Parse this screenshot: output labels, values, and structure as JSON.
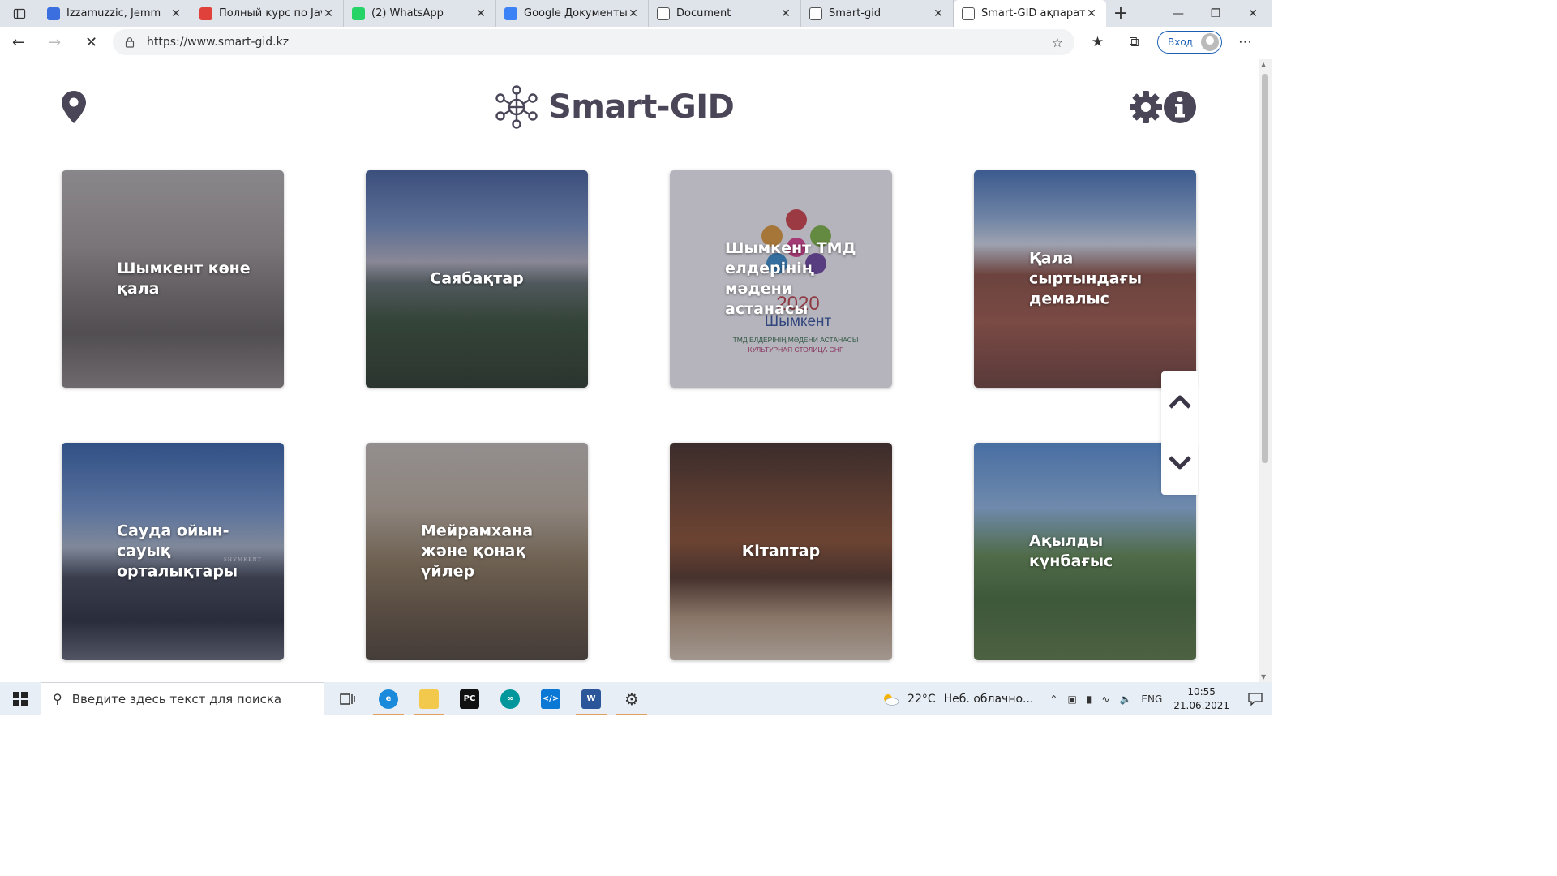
{
  "browser": {
    "tabs": [
      {
        "title": "Izzamuzzic, Jemm",
        "fav_color": "#3b6fe0",
        "icon": "media-player-icon"
      },
      {
        "title": "Полный курс по Java",
        "fav_color": "#e0413a",
        "icon": "course-site-icon"
      },
      {
        "title": "(2) WhatsApp",
        "fav_color": "#25d366",
        "icon": "whatsapp-icon"
      },
      {
        "title": "Google Документы",
        "fav_color": "#3b82f6",
        "icon": "google-docs-icon"
      },
      {
        "title": "Document",
        "fav_color": "#ffffff",
        "icon": "page-icon"
      },
      {
        "title": "Smart-gid",
        "fav_color": "#ffffff",
        "icon": "page-icon"
      },
      {
        "title": "Smart-GID ақпаратты",
        "fav_color": "#ffffff",
        "icon": "loading-icon"
      }
    ],
    "active_tab_index": 6,
    "url": "https://www.smart-gid.kz",
    "signin_label": "Вход"
  },
  "site": {
    "brand": "Smart-GID",
    "brand_color": "#4a4658",
    "cards": [
      {
        "label": "Шымкент көне қала",
        "theme": "old-city-sepia"
      },
      {
        "label": "Саябақтар",
        "theme": "park-evening"
      },
      {
        "label": "Шымкент ТМД елдерінің мәдени астанасы",
        "theme": "logo-card",
        "logo_year": "2020",
        "logo_city": "Шымкент",
        "logo_line1": "ТМД ЕЛДЕРІНІҢ МӘДЕНИ АСТАНАСЫ",
        "logo_line2": "КУЛЬТУРНАЯ СТОЛИЦА СНГ"
      },
      {
        "label": "Қала сыртындағы демалыс",
        "theme": "hotel-sky"
      },
      {
        "label": "Сауда ойын-сауық орталықтары",
        "theme": "mall-blue",
        "mall_sign": "SHYMKENT"
      },
      {
        "label": "Мейрамхана және қонақ үйлер",
        "theme": "restaurant-warm"
      },
      {
        "label": "Кітаптар",
        "theme": "library-brown"
      },
      {
        "label": "Ақылды күнбағыс",
        "theme": "solar-tree-green"
      }
    ]
  },
  "taskbar": {
    "search_placeholder": "Введите здесь текст для поиска",
    "weather_temp": "22°C",
    "weather_text": "Неб. облачно...",
    "lang": "ENG",
    "time": "10:55",
    "date": "21.06.2021"
  }
}
